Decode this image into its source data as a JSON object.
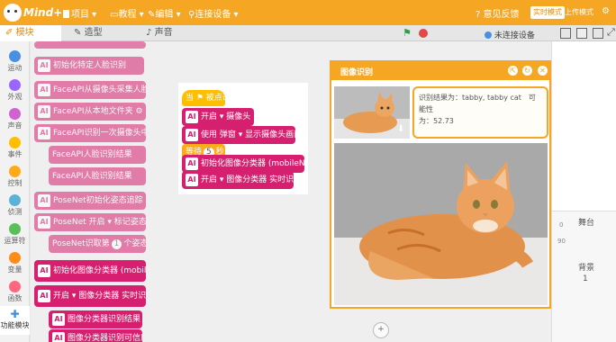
{
  "app": {
    "logo_text": "Mind+"
  },
  "menu": {
    "project": "项目 ▾",
    "tutorial": "教程 ▾",
    "edit": "编辑 ▾",
    "connect": "连接设备 ▾"
  },
  "topright": {
    "feedback": "意见反馈",
    "realtime_mode": "实时模式",
    "upload_mode": "上传模式"
  },
  "tabs": {
    "blocks": "模块",
    "costumes": "造型",
    "sounds": "声音"
  },
  "categories": [
    "运动",
    "外观",
    "声音",
    "事件",
    "控制",
    "侦测",
    "运算符",
    "变量",
    "函数",
    "功能模块"
  ],
  "palette": [
    "初始化特定人脸识别",
    "FaceAPI从摄像头采集人脸数据",
    "FaceAPI从本地文件夹",
    "FaceAPI识别一次摄像头中的人",
    "FaceAPI人脸识别结果",
    "FaceAPI人脸识别结果",
    "PoseNet初始化姿态追踪",
    "PoseNet 开启 ▾ 标记姿态关键点",
    "PoseNet识取第",
    "初始化图像分类器 (mobileNet)",
    "开启 ▾ 图像分类器 实时识别",
    "图像分类器识别结果",
    "图像分类器识别可信度"
  ],
  "palette_pills": {
    "posenet_index": "1",
    "posenet_tail": "个姿态"
  },
  "script": {
    "hat": "当 ⚑ 被点击",
    "b1_a": "开启 ▾",
    "b1_b": "摄像头",
    "b2_a": "使用",
    "b2_b": "弹窗 ▾",
    "b2_c": "显示摄像头画面",
    "wait_a": "等待",
    "wait_n": "5",
    "wait_b": "秒",
    "b3": "初始化图像分类器 (mobileNet)",
    "b4_a": "开启 ▾",
    "b4_b": "图像分类器 实时识别"
  },
  "stagebar": {
    "status": "未连接设备"
  },
  "stage_panel": {
    "stage_label": "舞台",
    "backdrop_label": "背景",
    "backdrop_count": "1",
    "coord1": "0",
    "coord2": "90"
  },
  "dialog": {
    "title": "图像识别",
    "result_line1": "识别结果为：tabby, tabby cat　可能性",
    "result_line2": "为：52.73"
  },
  "colors": {
    "accent": "#f5a623",
    "ai_block": "#d6206f"
  }
}
